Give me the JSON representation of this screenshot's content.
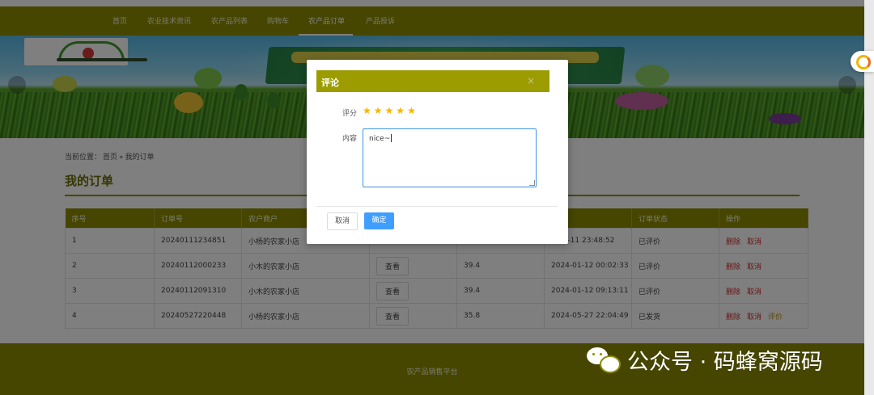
{
  "nav": {
    "items": [
      {
        "label": "首页"
      },
      {
        "label": "农业技术资讯"
      },
      {
        "label": "农产品列表"
      },
      {
        "label": "购物车"
      },
      {
        "label": "农产品订单"
      },
      {
        "label": "产品投诉"
      }
    ],
    "active_index": 4
  },
  "breadcrumb": {
    "prefix": "当前位置：",
    "home": "首页",
    "separator": "»",
    "current": "我的订单"
  },
  "page_title": "我的订单",
  "orders_table": {
    "columns": [
      "序号",
      "订单号",
      "农户商户",
      "",
      "",
      "时间",
      "订单状态",
      "操作"
    ],
    "view_label": "查看",
    "rows": [
      {
        "no": "1",
        "order_no": "20240111234851",
        "shop": "小杨的农家小店",
        "price": "",
        "time": "4-01-11 23:48:52",
        "status": "已评价",
        "ops": [
          "删除",
          "取消"
        ]
      },
      {
        "no": "2",
        "order_no": "20240112000233",
        "shop": "小木的农家小店",
        "price": "39.4",
        "time": "2024-01-12 00:02:33",
        "status": "已评价",
        "ops": [
          "删除",
          "取消"
        ]
      },
      {
        "no": "3",
        "order_no": "20240112091310",
        "shop": "小木的农家小店",
        "price": "39.4",
        "time": "2024-01-12 09:13:11",
        "status": "已评价",
        "ops": [
          "删除",
          "取消"
        ]
      },
      {
        "no": "4",
        "order_no": "20240527220448",
        "shop": "小杨的农家小店",
        "price": "35.8",
        "time": "2024-05-27 22:04:49",
        "status": "已发货",
        "ops": [
          "删除",
          "取消",
          "评价"
        ]
      }
    ]
  },
  "footer": {
    "text": "农产品销售平台"
  },
  "dialog": {
    "title": "评论",
    "close": "×",
    "rating_label": "评分",
    "rating": 5,
    "stars": [
      "★",
      "★",
      "★",
      "★",
      "★"
    ],
    "content_label": "内容",
    "content_value": "nice~",
    "cancel_label": "取消",
    "confirm_label": "确定"
  },
  "watermark": {
    "text": "公众号 · 码蜂窝源码"
  },
  "colors": {
    "brand_olive": "#8c8c00",
    "dialog_header": "#9c9c00",
    "primary_blue": "#409eff",
    "star_gold": "#f7b500",
    "danger_red": "#d62b2b"
  },
  "icons": {
    "float_button": "assistant-ring-icon",
    "watermark": "wechat-icon",
    "close": "close-icon"
  }
}
